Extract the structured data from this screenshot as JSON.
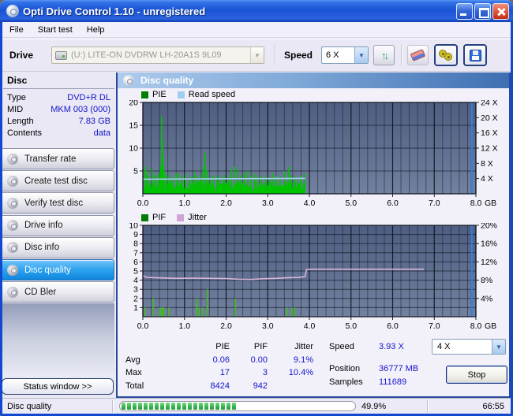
{
  "window": {
    "title": "Opti Drive Control 1.10 - unregistered"
  },
  "menu": {
    "items": [
      "File",
      "Start test",
      "Help"
    ]
  },
  "toolbar": {
    "drive_label": "Drive",
    "drive_value": "(U:)  LITE-ON DVDRW LH-20A1S 9L09",
    "speed_label": "Speed",
    "speed_value": "6 X",
    "icons": [
      "drive-icon",
      "refresh-icon",
      "eraser-icon",
      "binoculars-icon",
      "save-icon"
    ]
  },
  "disc_panel": {
    "title": "Disc",
    "rows": [
      {
        "label": "Type",
        "value": "DVD+R DL"
      },
      {
        "label": "MID",
        "value": "MKM 003 (000)"
      },
      {
        "label": "Length",
        "value": "7.83 GB"
      },
      {
        "label": "Contents",
        "value": "data"
      }
    ]
  },
  "sidebar": {
    "items": [
      {
        "label": "Transfer rate",
        "selected": false
      },
      {
        "label": "Create test disc",
        "selected": false
      },
      {
        "label": "Verify test disc",
        "selected": false
      },
      {
        "label": "Drive info",
        "selected": false
      },
      {
        "label": "Disc info",
        "selected": false
      },
      {
        "label": "Disc quality",
        "selected": true
      },
      {
        "label": "CD Bler",
        "selected": false
      }
    ],
    "status_button": "Status window >>"
  },
  "main": {
    "header": "Disc quality"
  },
  "chart_data": [
    {
      "type": "bar",
      "title": "PIE / Read speed",
      "legend": [
        {
          "label": "PIE",
          "color": "#007d00"
        },
        {
          "label": "Read speed",
          "color": "#9ecff2"
        }
      ],
      "x_unit": "GB",
      "xlim": [
        0,
        8
      ],
      "x_major_ticks": [
        "0.0",
        "1.0",
        "2.0",
        "3.0",
        "4.0",
        "5.0",
        "6.0",
        "7.0",
        "8.0"
      ],
      "x_minor_step": 0.2,
      "y_left": {
        "lim": [
          0,
          20
        ],
        "ticks": [
          5,
          10,
          15,
          20
        ]
      },
      "y_right": {
        "lim": [
          0,
          24
        ],
        "ticks": [
          4,
          8,
          12,
          16,
          20,
          24
        ],
        "suffix": " X"
      },
      "series": [
        {
          "name": "PIE",
          "kind": "noise-bars",
          "color": "#00c300",
          "from": 0,
          "to": 3.9,
          "min": 0.8,
          "max": 2.9,
          "seed": 7,
          "spikes": [
            [
              0.05,
              6
            ],
            [
              0.09,
              5
            ],
            [
              0.13,
              4
            ],
            [
              0.22,
              5.5
            ],
            [
              0.27,
              4
            ],
            [
              0.32,
              4.2
            ],
            [
              0.38,
              4.6
            ],
            [
              0.43,
              6
            ],
            [
              0.455,
              17
            ],
            [
              0.47,
              12
            ],
            [
              0.49,
              8
            ],
            [
              0.52,
              5
            ],
            [
              0.58,
              4
            ],
            [
              0.65,
              4.2
            ],
            [
              0.72,
              3.6
            ],
            [
              0.8,
              4.4
            ],
            [
              0.85,
              4.6
            ],
            [
              0.95,
              3.8
            ],
            [
              1.02,
              4.4
            ],
            [
              1.1,
              3.6
            ],
            [
              1.18,
              3.9
            ],
            [
              1.25,
              4.8
            ],
            [
              1.3,
              3.7
            ],
            [
              1.38,
              4.2
            ],
            [
              1.45,
              6
            ],
            [
              1.5,
              9
            ],
            [
              1.54,
              5.2
            ],
            [
              1.62,
              3.8
            ],
            [
              1.7,
              4.1
            ],
            [
              1.78,
              3.6
            ],
            [
              1.85,
              3.9
            ],
            [
              1.95,
              4.2
            ],
            [
              2.05,
              3.7
            ],
            [
              2.12,
              5.3
            ],
            [
              2.2,
              6
            ],
            [
              2.28,
              5.5
            ],
            [
              2.35,
              4.1
            ],
            [
              2.45,
              4.6
            ],
            [
              2.52,
              5
            ],
            [
              2.6,
              3.8
            ],
            [
              2.68,
              4.4
            ],
            [
              2.75,
              3.7
            ],
            [
              2.85,
              4.1
            ],
            [
              2.95,
              3.8
            ],
            [
              3.05,
              3.6
            ],
            [
              3.12,
              4.5
            ],
            [
              3.2,
              4
            ],
            [
              3.3,
              3.7
            ],
            [
              3.4,
              5
            ],
            [
              3.5,
              6
            ],
            [
              3.56,
              4.2
            ],
            [
              3.65,
              3.8
            ],
            [
              3.72,
              3.6
            ],
            [
              3.8,
              4
            ],
            [
              3.88,
              4.5
            ]
          ]
        },
        {
          "name": "Read speed",
          "kind": "line",
          "color": "#a9cff2",
          "axis": "right",
          "points": [
            [
              0,
              3.85
            ],
            [
              3.9,
              4.05
            ]
          ]
        }
      ],
      "marker": {
        "x": 7.9,
        "color": "#2f80e0"
      }
    },
    {
      "type": "bar",
      "title": "PIF / Jitter",
      "legend": [
        {
          "label": "PIF",
          "color": "#007d00"
        },
        {
          "label": "Jitter",
          "color": "#cfa3d4"
        }
      ],
      "x_unit": "GB",
      "xlim": [
        0,
        8
      ],
      "x_major_ticks": [
        "0.0",
        "1.0",
        "2.0",
        "3.0",
        "4.0",
        "5.0",
        "6.0",
        "7.0",
        "8.0"
      ],
      "x_minor_step": 0.2,
      "y_left": {
        "lim": [
          0,
          10
        ],
        "ticks": [
          1,
          2,
          3,
          4,
          5,
          6,
          7,
          8,
          9,
          10
        ]
      },
      "y_right": {
        "lim": [
          0,
          20
        ],
        "ticks": [
          4,
          8,
          12,
          16,
          20
        ],
        "suffix": "%"
      },
      "series": [
        {
          "name": "PIF",
          "kind": "bars",
          "color": "#49b234",
          "bars": [
            [
              0.05,
              1
            ],
            [
              0.25,
              2
            ],
            [
              0.41,
              1
            ],
            [
              0.44,
              1
            ],
            [
              0.47,
              1
            ],
            [
              0.5,
              1
            ],
            [
              0.62,
              1
            ],
            [
              1.3,
              2
            ],
            [
              1.36,
              1
            ],
            [
              1.42,
              1
            ],
            [
              1.55,
              3
            ],
            [
              2.22,
              2
            ],
            [
              3.47,
              1
            ],
            [
              3.58,
              1
            ],
            [
              3.64,
              1
            ]
          ]
        },
        {
          "name": "Jitter",
          "kind": "line",
          "color": "#d9b7dc",
          "axis": "right",
          "points": [
            [
              0,
              9.0
            ],
            [
              0.1,
              8.6
            ],
            [
              0.4,
              8.5
            ],
            [
              0.8,
              8.4
            ],
            [
              1.2,
              8.45
            ],
            [
              1.6,
              8.4
            ],
            [
              2.0,
              8.35
            ],
            [
              2.3,
              8.2
            ],
            [
              2.6,
              8.15
            ],
            [
              2.9,
              8.3
            ],
            [
              3.2,
              8.4
            ],
            [
              3.5,
              8.55
            ],
            [
              3.75,
              8.6
            ],
            [
              3.9,
              8.8
            ],
            [
              3.93,
              10.3
            ],
            [
              4.0,
              10.4
            ],
            [
              6.75,
              10.4
            ]
          ]
        }
      ],
      "marker": {
        "x": 7.9,
        "color": "#2f80e0"
      }
    }
  ],
  "stats": {
    "columns": [
      "PIE",
      "PIF",
      "Jitter"
    ],
    "rows": [
      {
        "label": "Avg",
        "values": [
          "0.06",
          "0.00",
          "9.1%"
        ]
      },
      {
        "label": "Max",
        "values": [
          "17",
          "3",
          "10.4%"
        ]
      },
      {
        "label": "Total",
        "values": [
          "8424",
          "942",
          ""
        ]
      }
    ],
    "right": [
      {
        "label": "Speed",
        "value": "3.93 X"
      },
      {
        "label": "Position",
        "value": "36777 MB"
      },
      {
        "label": "Samples",
        "value": "111689"
      }
    ],
    "speed_select": "4 X",
    "stop_label": "Stop"
  },
  "statusbar": {
    "task": "Disc quality",
    "progress_value": 49.9,
    "progress_percent": "49.9%",
    "time": "66:55"
  }
}
